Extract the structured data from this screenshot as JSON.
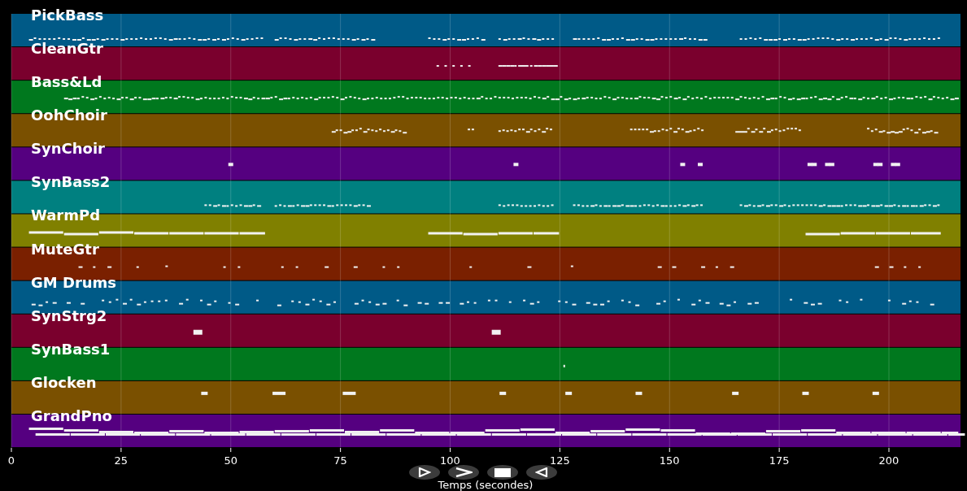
{
  "tracks": [
    {
      "name": "PickBass",
      "color": "#005a87"
    },
    {
      "name": "CleanGtr",
      "color": "#7a002d"
    },
    {
      "name": "Bass&Ld",
      "color": "#00781e"
    },
    {
      "name": "OohChoir",
      "color": "#7a5000"
    },
    {
      "name": "SynChoir",
      "color": "#550080"
    },
    {
      "name": "SynBass2",
      "color": "#008080"
    },
    {
      "name": "WarmPd",
      "color": "#808000"
    },
    {
      "name": "MuteGtr",
      "color": "#7a2000"
    },
    {
      "name": "GM Drums",
      "color": "#005a87"
    },
    {
      "name": "SynStrg2",
      "color": "#7a002d"
    },
    {
      "name": "SynBass1",
      "color": "#00781e"
    },
    {
      "name": "Glocken",
      "color": "#7a5000"
    },
    {
      "name": "GrandPno",
      "color": "#550080"
    }
  ],
  "x_axis": {
    "ticks": [
      "0",
      "25",
      "50",
      "75",
      "100",
      "125",
      "150",
      "175",
      "200"
    ],
    "label": "Temps (secondes)"
  },
  "controls": [
    {
      "kind": "play"
    },
    {
      "kind": "forward"
    },
    {
      "kind": "stop"
    },
    {
      "kind": "back"
    }
  ]
}
